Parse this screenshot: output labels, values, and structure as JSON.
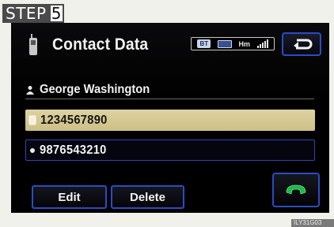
{
  "step": {
    "label": "STEP",
    "number": "5"
  },
  "screen": {
    "title": "Contact Data",
    "status": {
      "bt": "BT",
      "home": "Hm"
    },
    "contact_name": "George Washington",
    "numbers": [
      {
        "value": "1234567890",
        "selected": true
      },
      {
        "value": "9876543210",
        "selected": false
      }
    ],
    "buttons": {
      "edit": "Edit",
      "delete": "Delete"
    },
    "colors": {
      "accent": "#2a4cc4",
      "selected_row": "#d6cb94",
      "call_green": "#1fb84a"
    }
  },
  "figure_code": "ILY31G03"
}
